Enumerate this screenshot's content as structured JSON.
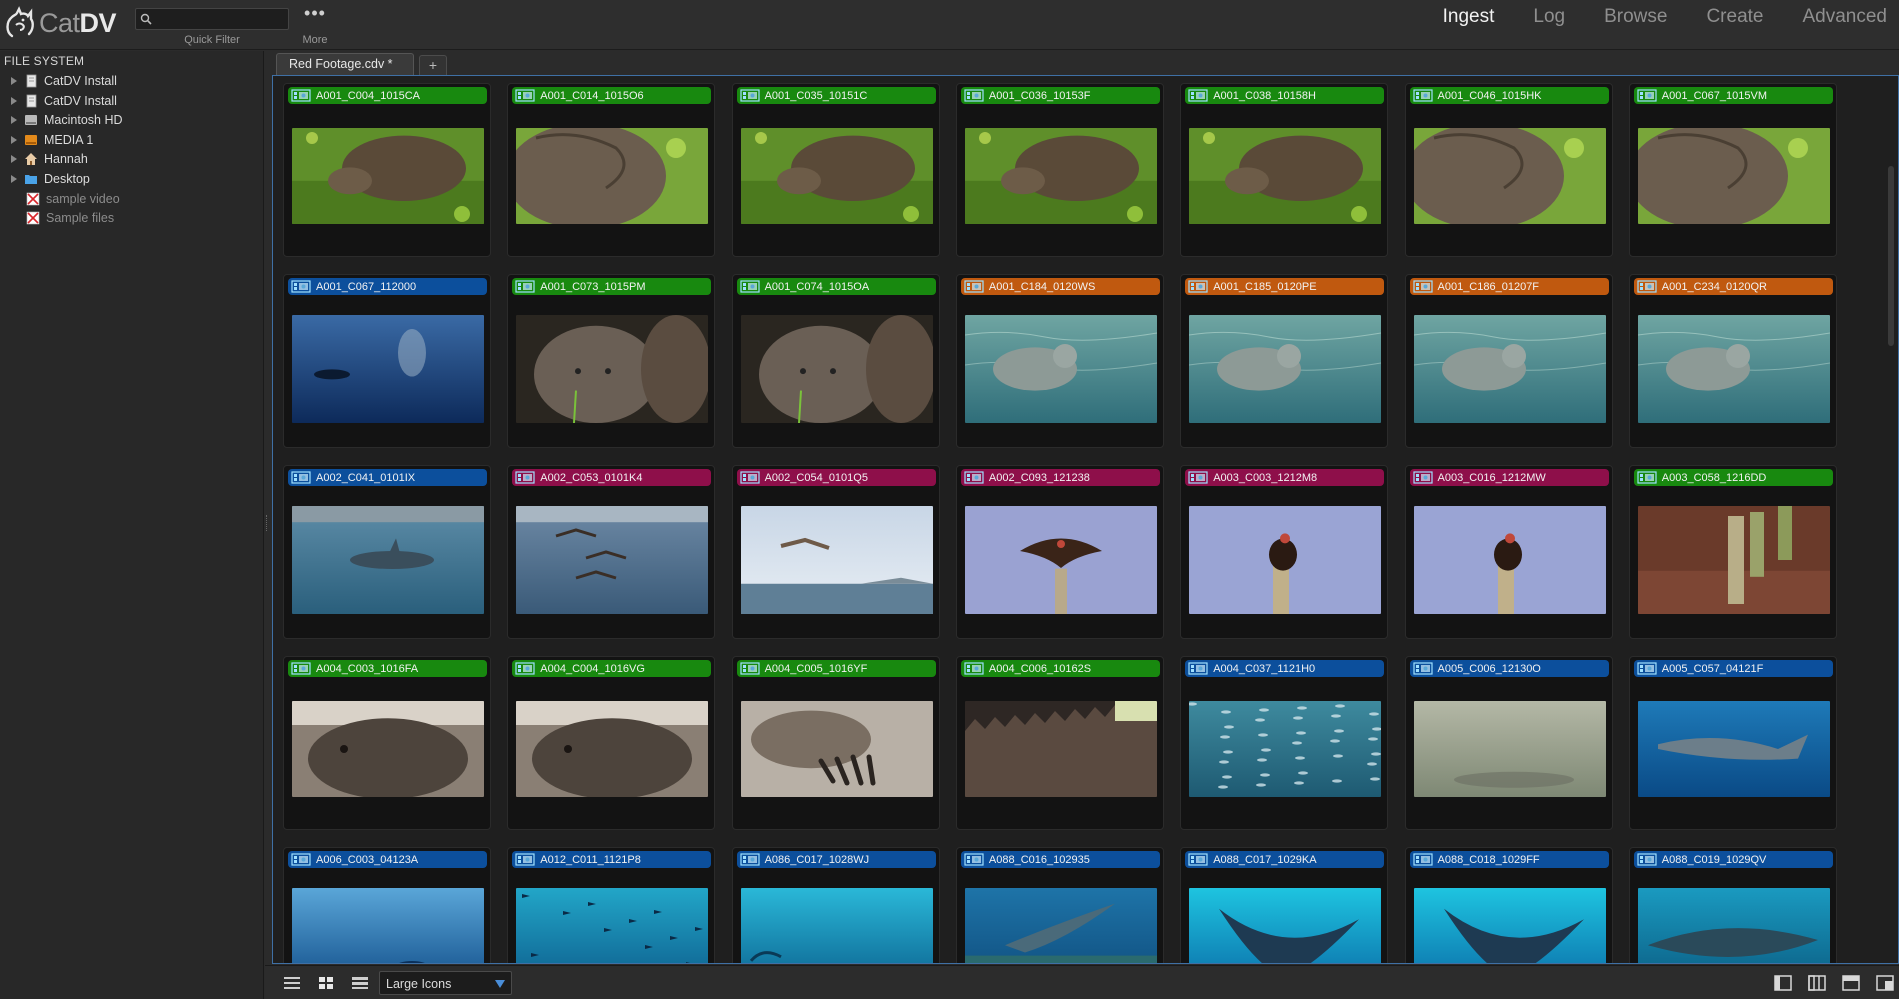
{
  "app": {
    "logo_text_light": "Cat",
    "logo_text_bold": "DV"
  },
  "toolbar": {
    "quick_filter_placeholder": "",
    "quick_filter_label": "Quick Filter",
    "more_icon": "•••",
    "more_label": "More"
  },
  "modes": [
    "Ingest",
    "Log",
    "Browse",
    "Create",
    "Advanced"
  ],
  "active_mode": "Ingest",
  "sidebar": {
    "header": "FILE SYSTEM",
    "items": [
      {
        "label": "CatDV Install",
        "icon": "document-icon",
        "expandable": true,
        "sub": false
      },
      {
        "label": "CatDV Install",
        "icon": "document-icon",
        "expandable": true,
        "sub": false
      },
      {
        "label": "Macintosh HD",
        "icon": "hard-drive-icon",
        "expandable": true,
        "sub": false
      },
      {
        "label": "MEDIA 1",
        "icon": "external-drive-icon",
        "expandable": true,
        "sub": false
      },
      {
        "label": "Hannah",
        "icon": "home-icon",
        "expandable": true,
        "sub": false
      },
      {
        "label": "Desktop",
        "icon": "folder-icon",
        "expandable": true,
        "sub": false
      },
      {
        "label": "sample video",
        "icon": "broken-image-icon",
        "expandable": false,
        "sub": true
      },
      {
        "label": "Sample files",
        "icon": "broken-image-icon",
        "expandable": false,
        "sub": true
      }
    ]
  },
  "tabs": {
    "current": "Red Footage.cdv *",
    "add_label": "+"
  },
  "colors": {
    "green": "#18890f",
    "blue": "#0c4f9c",
    "orange": "#c0590f",
    "magenta": "#8e0f4a",
    "accent": "#3f70a5"
  },
  "clips": [
    {
      "name": "A001_C004_1015CA",
      "label": "green",
      "thumb": "tortoise-grass"
    },
    {
      "name": "A001_C014_1015O6",
      "label": "green",
      "thumb": "tortoise-close"
    },
    {
      "name": "A001_C035_10151C",
      "label": "green",
      "thumb": "tortoise-grass"
    },
    {
      "name": "A001_C036_10153F",
      "label": "green",
      "thumb": "tortoise-grass"
    },
    {
      "name": "A001_C038_10158H",
      "label": "green",
      "thumb": "tortoise-grass"
    },
    {
      "name": "A001_C046_1015HK",
      "label": "green",
      "thumb": "tortoise-close"
    },
    {
      "name": "A001_C067_1015VM",
      "label": "green",
      "thumb": "tortoise-close"
    },
    {
      "name": "A001_C067_112000",
      "label": "blue",
      "thumb": "underwater-dark"
    },
    {
      "name": "A001_C073_1015PM",
      "label": "green",
      "thumb": "tortoise-face"
    },
    {
      "name": "A001_C074_1015OA",
      "label": "green",
      "thumb": "tortoise-face"
    },
    {
      "name": "A001_C184_0120WS",
      "label": "orange",
      "thumb": "sealion-water"
    },
    {
      "name": "A001_C185_0120PE",
      "label": "orange",
      "thumb": "sealion-water"
    },
    {
      "name": "A001_C186_01207F",
      "label": "orange",
      "thumb": "sealion-water"
    },
    {
      "name": "A001_C234_0120QR",
      "label": "orange",
      "thumb": "sealion-water"
    },
    {
      "name": "A002_C041_0101IX",
      "label": "blue",
      "thumb": "dolphin"
    },
    {
      "name": "A002_C053_0101K4",
      "label": "magenta",
      "thumb": "pelicans"
    },
    {
      "name": "A002_C054_0101Q5",
      "label": "magenta",
      "thumb": "bird-sky"
    },
    {
      "name": "A002_C093_121238",
      "label": "magenta",
      "thumb": "vulture"
    },
    {
      "name": "A003_C003_1212M8",
      "label": "magenta",
      "thumb": "vulture-perched"
    },
    {
      "name": "A003_C016_1212MW",
      "label": "magenta",
      "thumb": "vulture-perched"
    },
    {
      "name": "A003_C058_1216DD",
      "label": "green",
      "thumb": "cactus"
    },
    {
      "name": "A004_C003_1016FA",
      "label": "green",
      "thumb": "iguana"
    },
    {
      "name": "A004_C004_1016VG",
      "label": "green",
      "thumb": "iguana"
    },
    {
      "name": "A004_C005_1016YF",
      "label": "green",
      "thumb": "iguana-claw"
    },
    {
      "name": "A004_C006_10162S",
      "label": "green",
      "thumb": "iguana-spines"
    },
    {
      "name": "A004_C037_1121H0",
      "label": "blue",
      "thumb": "fish-school"
    },
    {
      "name": "A005_C006_12130O",
      "label": "blue",
      "thumb": "murky-water"
    },
    {
      "name": "A005_C057_04121F",
      "label": "blue",
      "thumb": "shark"
    },
    {
      "name": "A006_C003_04123A",
      "label": "blue",
      "thumb": "underwater-blue"
    },
    {
      "name": "A012_C011_1121P8",
      "label": "blue",
      "thumb": "hammerheads"
    },
    {
      "name": "A086_C017_1028WJ",
      "label": "blue",
      "thumb": "underwater-teal"
    },
    {
      "name": "A088_C016_102935",
      "label": "blue",
      "thumb": "ray-seafloor"
    },
    {
      "name": "A088_C017_1029KA",
      "label": "blue",
      "thumb": "ray-teal"
    },
    {
      "name": "A088_C018_1029FF",
      "label": "blue",
      "thumb": "ray-teal"
    },
    {
      "name": "A088_C019_1029QV",
      "label": "blue",
      "thumb": "whaleshark"
    }
  ],
  "bottom": {
    "view_mode": "Large Icons"
  }
}
